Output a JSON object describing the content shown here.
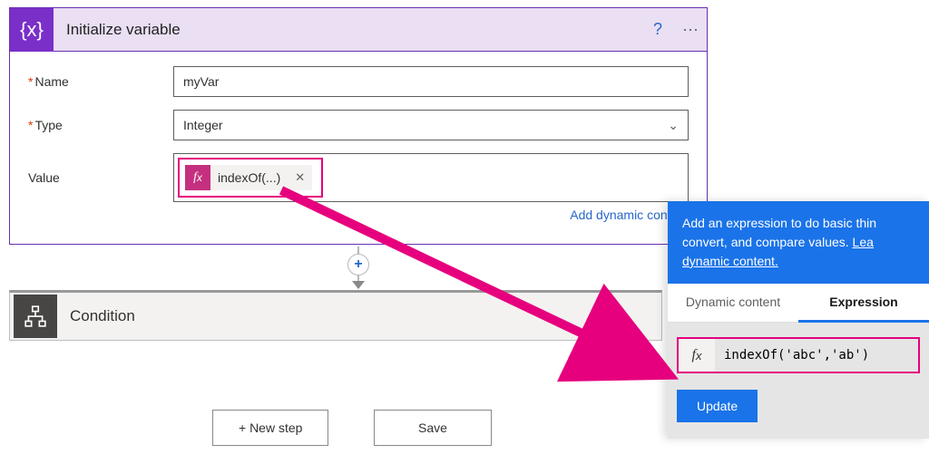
{
  "initVar": {
    "title": "Initialize variable",
    "fields": {
      "name_label": "Name",
      "name_value": "myVar",
      "type_label": "Type",
      "type_value": "Integer",
      "value_label": "Value",
      "token_text": "indexOf(...)"
    },
    "add_dynamic": "Add dynamic content"
  },
  "condition": {
    "title": "Condition"
  },
  "buttons": {
    "new_step": "+ New step",
    "save": "Save"
  },
  "exprPanel": {
    "hint_line1": "Add an expression to do basic thin",
    "hint_line2": "convert, and compare values. ",
    "hint_link_prefix": "Lea",
    "hint_link": "dynamic content.",
    "tab_dynamic": "Dynamic content",
    "tab_expr": "Expression",
    "expression": "indexOf('abc','ab')",
    "update": "Update"
  },
  "icons": {
    "help": "?",
    "more": "···",
    "close_token": "✕",
    "plus": "+",
    "chevron_down": "⌄"
  }
}
